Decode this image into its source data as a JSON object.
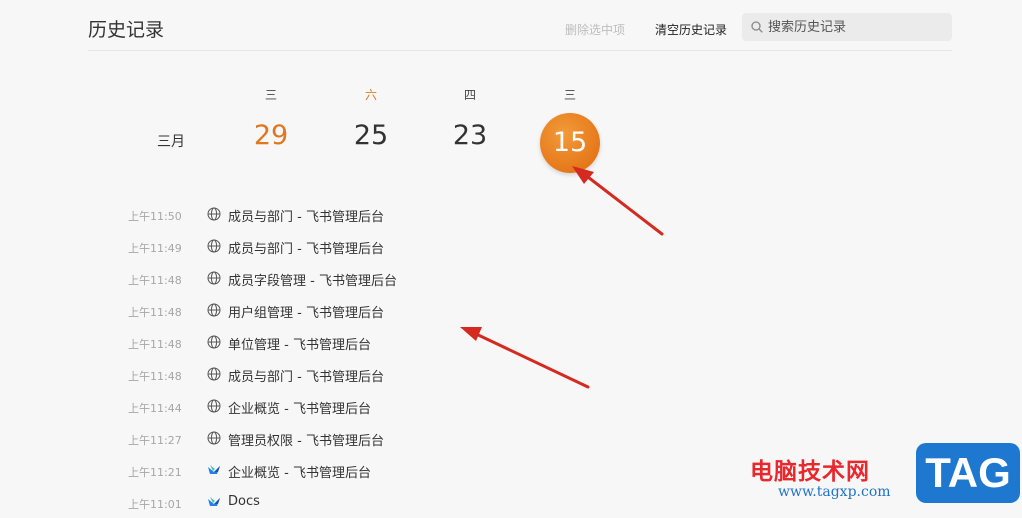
{
  "header": {
    "title": "历史记录",
    "delete_selected": "删除选中项",
    "clear_history": "清空历史记录",
    "search_placeholder": "搜索历史记录"
  },
  "calendar": {
    "month": "三月",
    "days": [
      {
        "weekday": "三",
        "date": "29"
      },
      {
        "weekday": "六",
        "date": "25"
      },
      {
        "weekday": "四",
        "date": "23"
      },
      {
        "weekday": "三",
        "date": "15",
        "selected": true
      }
    ]
  },
  "history": [
    {
      "time": "上午11:50",
      "title": "成员与部门 - 飞书管理后台",
      "icon": "globe-icon"
    },
    {
      "time": "上午11:49",
      "title": "成员与部门 - 飞书管理后台",
      "icon": "globe-icon"
    },
    {
      "time": "上午11:48",
      "title": "成员字段管理 - 飞书管理后台",
      "icon": "globe-icon"
    },
    {
      "time": "上午11:48",
      "title": "用户组管理 - 飞书管理后台",
      "icon": "globe-icon"
    },
    {
      "time": "上午11:48",
      "title": "单位管理 - 飞书管理后台",
      "icon": "globe-icon"
    },
    {
      "time": "上午11:48",
      "title": "成员与部门 - 飞书管理后台",
      "icon": "globe-icon"
    },
    {
      "time": "上午11:44",
      "title": "企业概览 - 飞书管理后台",
      "icon": "globe-icon"
    },
    {
      "time": "上午11:27",
      "title": "管理员权限 - 飞书管理后台",
      "icon": "globe-icon"
    },
    {
      "time": "上午11:21",
      "title": "企业概览 - 飞书管理后台",
      "icon": "feishu-icon"
    },
    {
      "time": "上午11:01",
      "title": "Docs",
      "icon": "feishu-icon"
    }
  ],
  "watermark": {
    "text": "电脑技术网",
    "url": "www.tagxp.com",
    "logo": "TAG"
  },
  "colors": {
    "accent": "#e07720",
    "annotation_arrow": "#d42a1f",
    "watermark_red": "#e8282c",
    "watermark_blue": "#1f78cf"
  }
}
